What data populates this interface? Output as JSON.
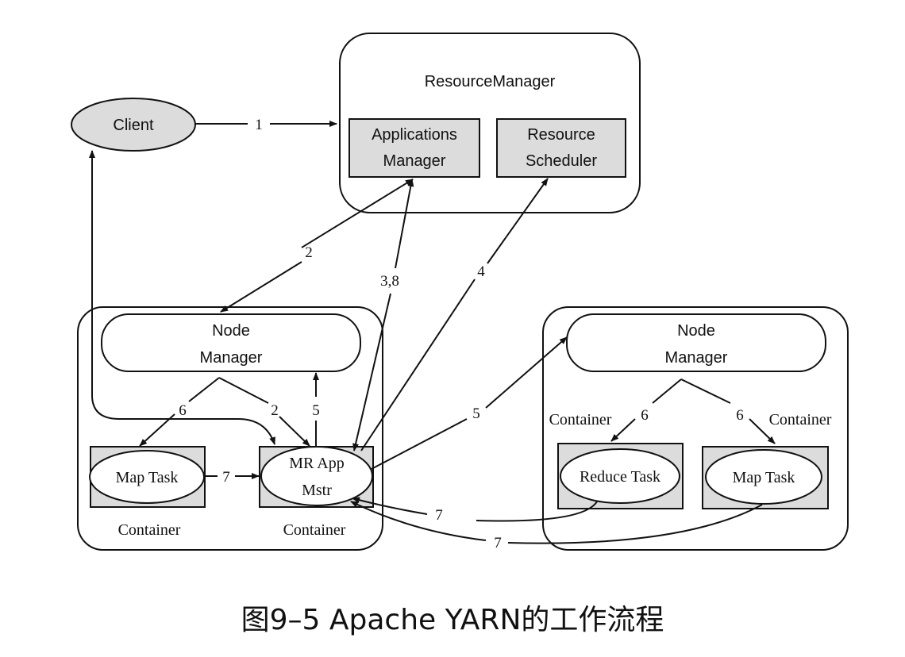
{
  "nodes": {
    "client": "Client",
    "resource_manager": "ResourceManager",
    "applications_manager": [
      "Applications",
      "Manager"
    ],
    "resource_scheduler": [
      "Resource",
      "Scheduler"
    ],
    "node_manager_left": [
      "Node",
      "Manager"
    ],
    "node_manager_right": [
      "Node",
      "Manager"
    ],
    "map_task_left": "Map Task",
    "mr_app_mstr": [
      "MR App",
      "Mstr"
    ],
    "reduce_task": "Reduce Task",
    "map_task_right": "Map Task",
    "container_left_1": "Container",
    "container_left_2": "Container",
    "container_right_1": "Container",
    "container_right_2": "Container"
  },
  "edges": {
    "e1": "1",
    "e2_top": "2",
    "e38": "3,8",
    "e4": "4",
    "e6_left": "6",
    "e2_left": "2",
    "e5_left": "5",
    "e7_left": "7",
    "e5_right": "5",
    "e6_right_1": "6",
    "e6_right_2": "6",
    "e7_bottom_1": "7",
    "e7_bottom_2": "7"
  },
  "caption": "图9–5 Apache YARN的工作流程"
}
